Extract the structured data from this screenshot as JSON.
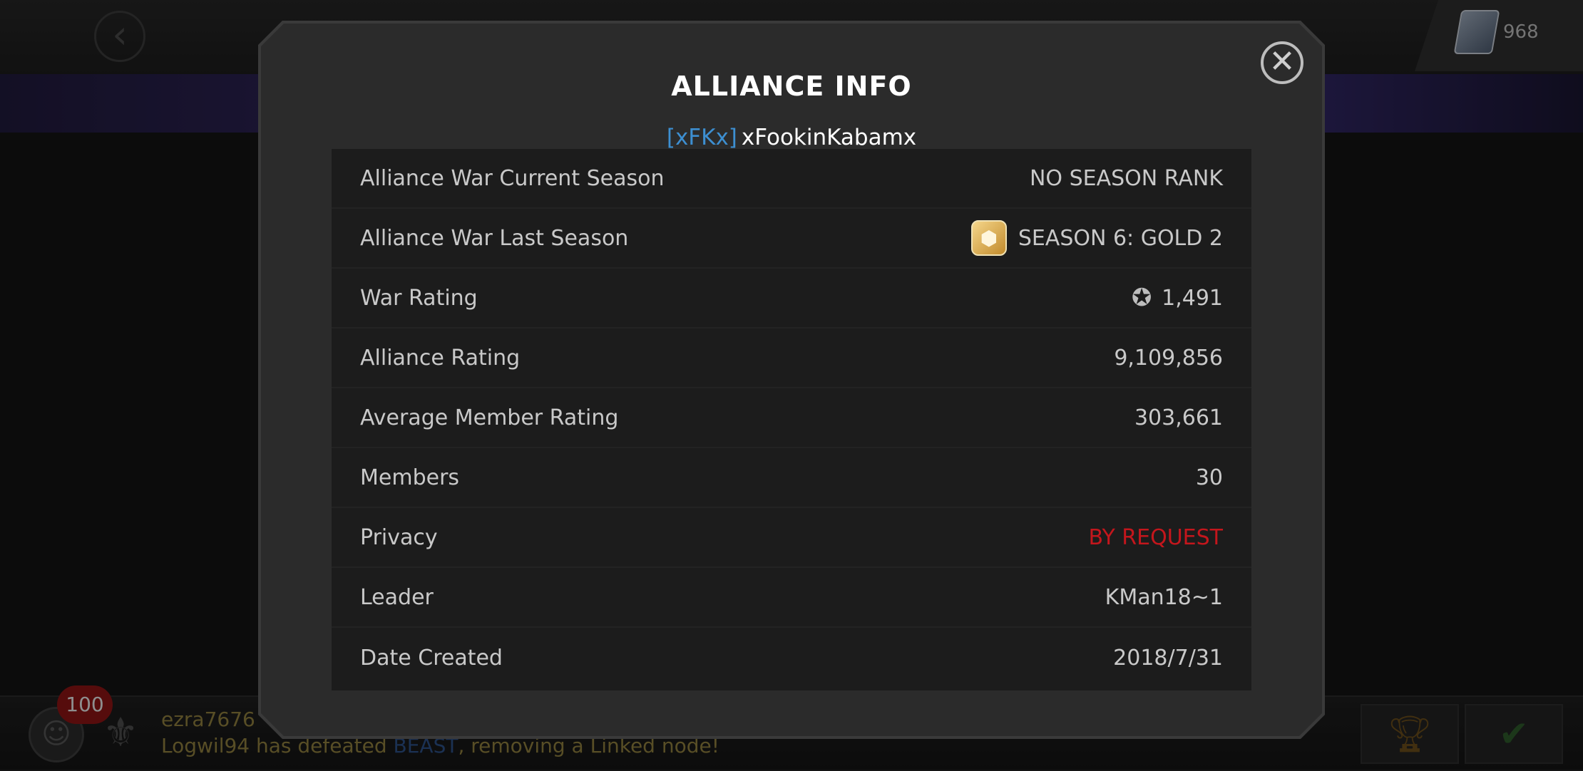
{
  "background": {
    "unit_count": "968",
    "chat_badge": "100",
    "chat_name": "ezra7676",
    "chat_prefix": "Logwil94 has defeated ",
    "chat_hero": "BEAST",
    "chat_suffix": ", removing a Linked node!"
  },
  "modal": {
    "title": "ALLIANCE INFO",
    "tag": "[xFKx]",
    "name": "xFookinKabamx",
    "rows": [
      {
        "label": "Alliance War Current Season",
        "value": "NO SEASON RANK"
      },
      {
        "label": "Alliance War Last Season",
        "value": "SEASON 6: GOLD 2"
      },
      {
        "label": "War Rating",
        "value": "1,491"
      },
      {
        "label": "Alliance Rating",
        "value": "9,109,856"
      },
      {
        "label": "Average Member Rating",
        "value": "303,661"
      },
      {
        "label": "Members",
        "value": "30"
      },
      {
        "label": "Privacy",
        "value": "BY REQUEST"
      },
      {
        "label": "Leader",
        "value": "KMan18~1"
      },
      {
        "label": "Date Created",
        "value": "2018/7/31"
      }
    ]
  },
  "icons": {
    "close": "close-icon",
    "gold_tier": "gold-tier-icon",
    "war_rating": "war-rating-icon"
  },
  "colors": {
    "tag": "#3d8fd1",
    "privacy": "#c4161c"
  }
}
